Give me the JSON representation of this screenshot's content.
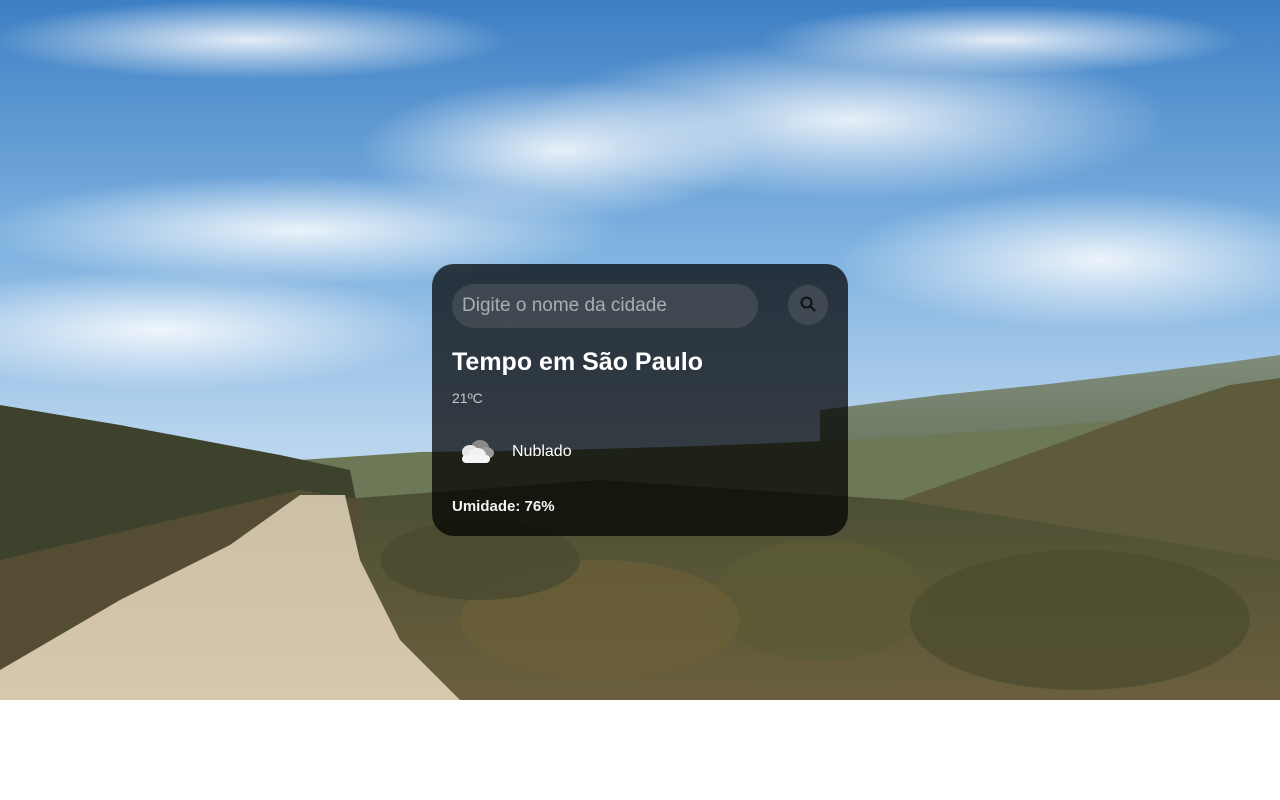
{
  "search": {
    "placeholder": "Digite o nome da cidade",
    "button_icon": "search-icon"
  },
  "weather": {
    "title": "Tempo em São Paulo",
    "temperature": "21ºC",
    "condition_icon": "cloud-icon",
    "condition": "Nublado",
    "humidity": "Umidade: 76%"
  },
  "colors": {
    "card_background": "#000000b8",
    "input_background": "#7d7d7d47",
    "text_primary": "#ffffff",
    "page_background": "#ffffff"
  }
}
